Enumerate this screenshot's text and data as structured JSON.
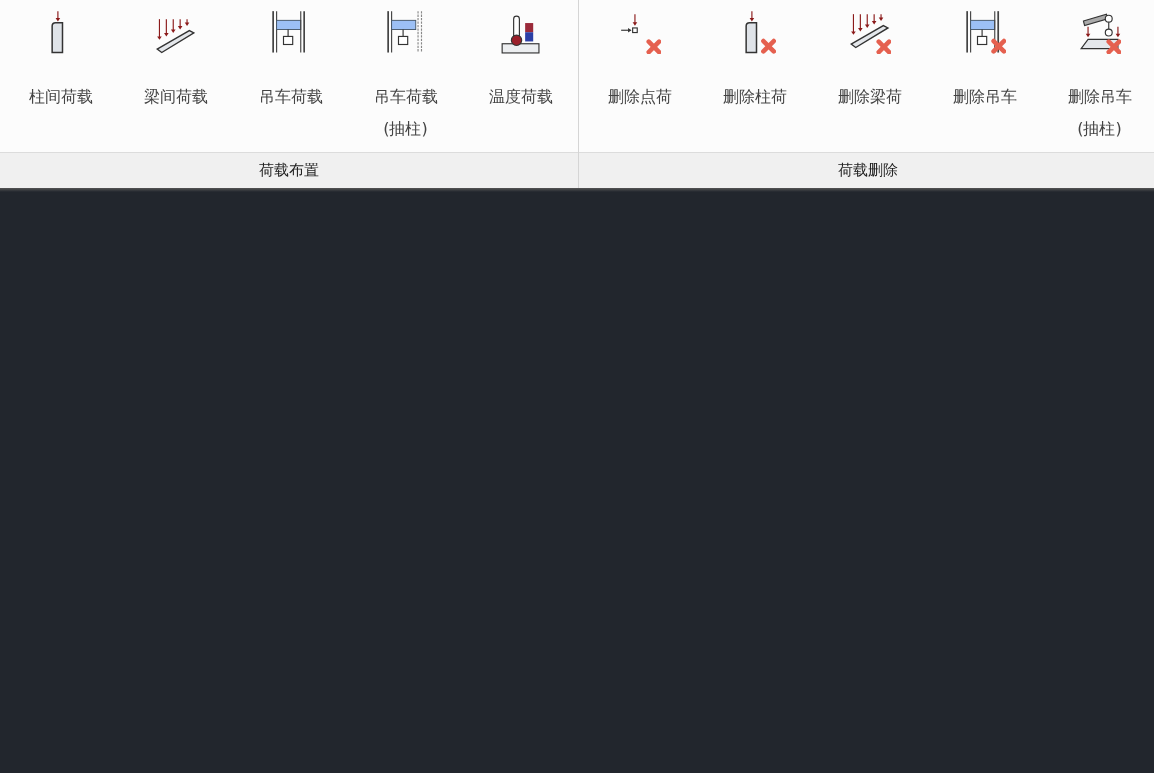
{
  "groups": [
    {
      "title": "荷载布置",
      "buttons": [
        {
          "label": "柱间荷载",
          "kind": "column",
          "delete": false
        },
        {
          "label": "梁间荷载",
          "kind": "beam",
          "delete": false
        },
        {
          "label": "吊车荷载",
          "kind": "crane",
          "delete": false
        },
        {
          "label": "吊车荷载",
          "sublabel": "(抽柱)",
          "kind": "crane_pull",
          "delete": false
        },
        {
          "label": "温度荷载",
          "kind": "temperature",
          "delete": false
        }
      ]
    },
    {
      "title": "荷载删除",
      "buttons": [
        {
          "label": "删除点荷",
          "kind": "point",
          "delete": true
        },
        {
          "label": "删除柱荷",
          "kind": "column",
          "delete": true
        },
        {
          "label": "删除梁荷",
          "kind": "beam",
          "delete": true
        },
        {
          "label": "删除吊车",
          "kind": "crane",
          "delete": true
        },
        {
          "label": "删除吊车",
          "sublabel": "(抽柱)",
          "kind": "gantry",
          "delete": true
        }
      ]
    }
  ]
}
